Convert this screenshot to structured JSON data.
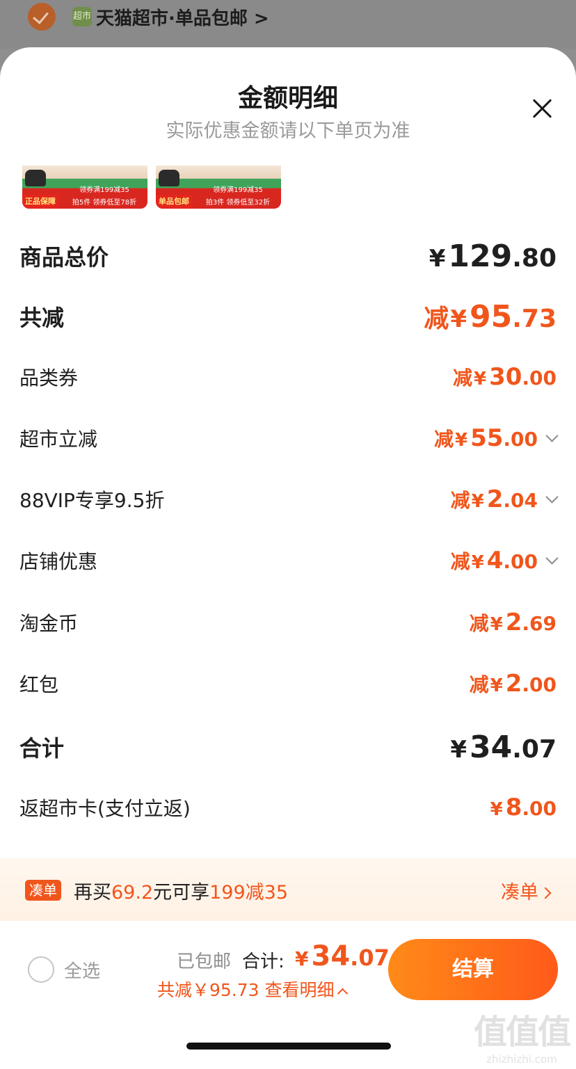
{
  "top": {
    "store_icon_text": "超市",
    "store_name": "天猫超市·单品包邮 >"
  },
  "sheet": {
    "title": "金额明细",
    "subtitle": "实际优惠金额请以下单页为准"
  },
  "products": [
    {
      "badge": "正品保障",
      "promo_line1": "领券满199减35",
      "promo_line2": "拍5件 领券低至78折"
    },
    {
      "badge": "单品包邮",
      "promo_line1": "领券满199减35",
      "promo_line2": "拍3件 领券低至32折"
    }
  ],
  "rows": [
    {
      "label": "商品总价",
      "prefix": "",
      "yen": "¥",
      "int": "129",
      "dec": ".80",
      "style": "major-dark",
      "expandable": false
    },
    {
      "label": "共减",
      "prefix": "减",
      "yen": "¥",
      "int": "95",
      "dec": ".73",
      "style": "major-orange",
      "expandable": false
    },
    {
      "label": "品类券",
      "prefix": "减",
      "yen": "¥",
      "int": "30",
      "dec": ".00",
      "style": "minor-orange",
      "expandable": false
    },
    {
      "label": "超市立减",
      "prefix": "减",
      "yen": "¥",
      "int": "55",
      "dec": ".00",
      "style": "minor-orange",
      "expandable": true
    },
    {
      "label": "88VIP专享9.5折",
      "prefix": "减",
      "yen": "¥",
      "int": "2",
      "dec": ".04",
      "style": "minor-orange",
      "expandable": true
    },
    {
      "label": "店铺优惠",
      "prefix": "减",
      "yen": "¥",
      "int": "4",
      "dec": ".00",
      "style": "minor-orange",
      "expandable": true
    },
    {
      "label": "淘金币",
      "prefix": "减",
      "yen": "¥",
      "int": "2",
      "dec": ".69",
      "style": "minor-orange",
      "expandable": false
    },
    {
      "label": "红包",
      "prefix": "减",
      "yen": "¥",
      "int": "2",
      "dec": ".00",
      "style": "minor-orange",
      "expandable": false
    },
    {
      "label": "合计",
      "prefix": "",
      "yen": "¥",
      "int": "34",
      "dec": ".07",
      "style": "major-dark",
      "expandable": false
    },
    {
      "label": "返超市卡(支付立返)",
      "prefix": "",
      "yen": "¥",
      "int": "8",
      "dec": ".00",
      "style": "minor-orange",
      "expandable": false
    }
  ],
  "coudan": {
    "tag": "凑单",
    "text_before": "再买",
    "amount": "69.2",
    "text_middle": "元可享",
    "deal": "199减35",
    "link": "凑单"
  },
  "checkout": {
    "select_all": "全选",
    "shipping": "已包邮",
    "total_label": "合计:",
    "total_yen": "¥",
    "total_int": "34",
    "total_dec": ".07",
    "saved": "共减￥95.73",
    "detail_link": "查看明细",
    "button": "结算"
  },
  "watermark": {
    "big": "值值值",
    "small": "zhizhizhi.com"
  },
  "colors": {
    "accent": "#f0561c",
    "button_start": "#ff8a18",
    "button_end": "#ff5a1a"
  }
}
